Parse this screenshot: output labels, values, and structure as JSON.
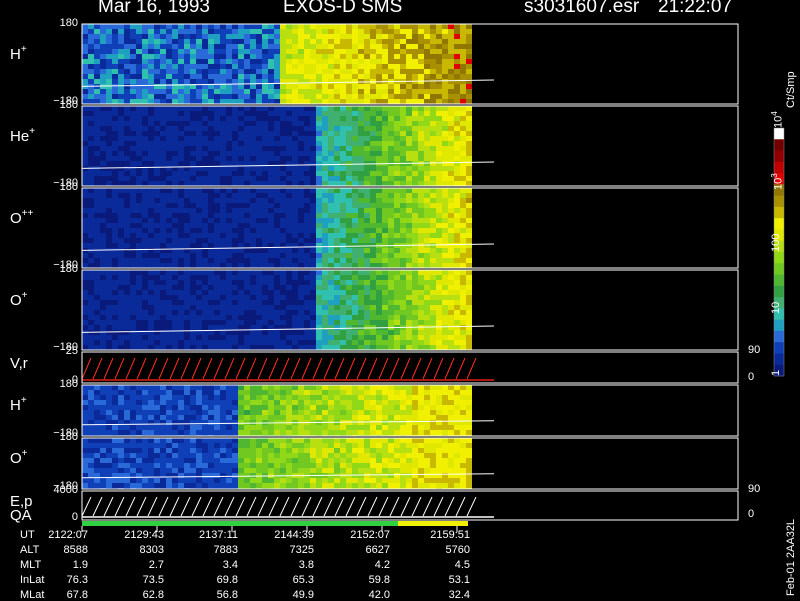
{
  "header": {
    "date": "Mar 16, 1993",
    "instrument": "EXOS-D SMS",
    "file": "s3031607.esr",
    "time": "21:22:07"
  },
  "panels": [
    {
      "label": "H",
      "sup": "+",
      "ymax": "180",
      "ymin": "−180"
    },
    {
      "label": "He",
      "sup": "+",
      "ymax": "180",
      "ymin": "−180"
    },
    {
      "label": "O",
      "sup": "++",
      "ymax": "180",
      "ymin": "−180"
    },
    {
      "label": "O",
      "sup": "+",
      "ymax": "180",
      "ymin": "−180"
    },
    {
      "label": "V,r",
      "sup": "",
      "ymax": "25",
      "ymin": "0",
      "rmax": "90",
      "rmin": "0"
    },
    {
      "label": "H",
      "sup": "+",
      "ymax": "180",
      "ymin": "−180"
    },
    {
      "label": "O",
      "sup": "+",
      "ymax": "180",
      "ymin": "−180"
    },
    {
      "label": "E,p",
      "sup": "",
      "ymax": "4000",
      "ymin": "0",
      "rmax": "90",
      "rmin": "0"
    }
  ],
  "qa_label": "QA",
  "colorbar": {
    "unit": "Ct/Smp",
    "labels": [
      {
        "base": "10",
        "exp": "4",
        "value": 10000
      },
      {
        "base": "10",
        "exp": "3",
        "value": 1000
      },
      {
        "base": "100",
        "exp": "",
        "value": 100
      },
      {
        "base": "10",
        "exp": "",
        "value": 10
      },
      {
        "base": "1",
        "exp": "",
        "value": 1
      }
    ],
    "colors": [
      "#0a1a7a",
      "#0a2a9a",
      "#1040b8",
      "#2a6ad8",
      "#20a0c0",
      "#30c0b0",
      "#40b070",
      "#30a040",
      "#50b830",
      "#70c820",
      "#90d818",
      "#b8e010",
      "#e0e800",
      "#f0f000",
      "#c8b800",
      "#a89000",
      "#907800",
      "#e00000",
      "#c00000",
      "#900000",
      "#700000",
      "#ffffff"
    ]
  },
  "ephemeris": {
    "row_labels": [
      "UT",
      "ALT",
      "MLT",
      "InLat",
      "MLat"
    ],
    "columns": [
      [
        "2122:07",
        "8588",
        "1.9",
        "76.3",
        "67.8"
      ],
      [
        "2129:43",
        "8303",
        "2.7",
        "73.5",
        "62.8"
      ],
      [
        "2137:11",
        "7883",
        "3.4",
        "69.8",
        "56.8"
      ],
      [
        "2144:39",
        "7325",
        "3.8",
        "65.3",
        "49.9"
      ],
      [
        "2152:07",
        "6627",
        "4.2",
        "59.8",
        "42.0"
      ],
      [
        "2159:51",
        "5760",
        "4.5",
        "53.1",
        "32.4"
      ]
    ]
  },
  "footer_id": "Feb-01 2AA32L",
  "chart_data": {
    "type": "heatmap",
    "title": "Mar 16, 1993 EXOS-D SMS",
    "x_ticks_UT": [
      "2122:07",
      "2129:43",
      "2137:11",
      "2144:39",
      "2152:07",
      "2159:51"
    ],
    "panels": [
      "H+",
      "He+",
      "O++",
      "O+",
      "V,r",
      "H+",
      "O+",
      "E,p"
    ],
    "pitch_angle_range": [
      -180,
      180
    ],
    "colorbar_range": [
      1,
      10000
    ],
    "colorbar_scale": "log",
    "data_end_UT": "2159:51"
  }
}
